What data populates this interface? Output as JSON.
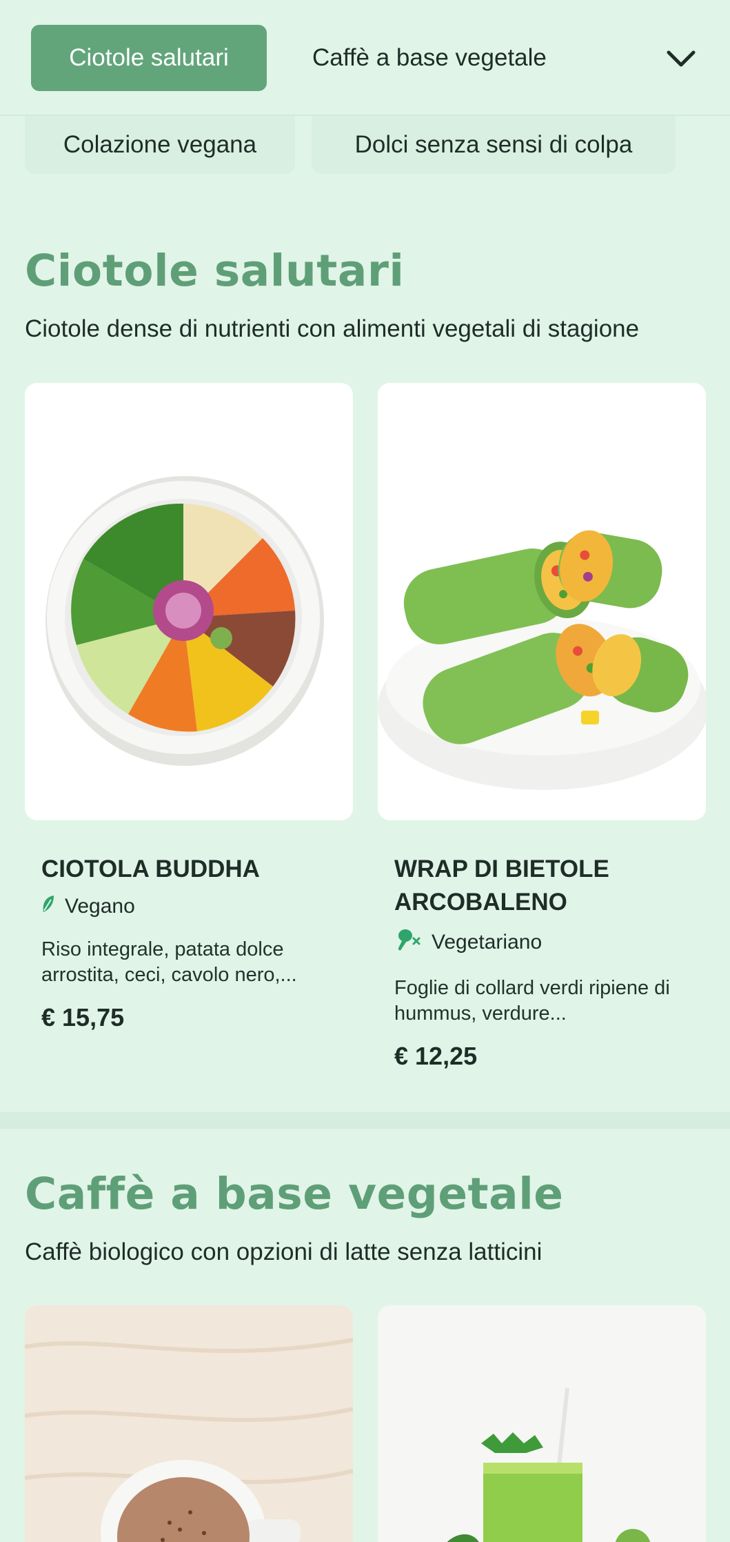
{
  "nav": {
    "active_category": "Ciotole salutari",
    "second_category": "Caffè a base vegetale",
    "row2": [
      "Colazione vegana",
      "Dolci senza sensi di colpa"
    ]
  },
  "sections": [
    {
      "title": "Ciotole salutari",
      "subtitle": "Ciotole dense di nutrienti con alimenti vegetali di stagione",
      "items": [
        {
          "name": "CIOTOLA BUDDHA",
          "tag": "Vegano",
          "tag_icon": "leaf-icon",
          "description": "Riso integrale, patata dolce arrostita, ceci, cavolo nero,...",
          "price": "€ 15,75"
        },
        {
          "name": "WRAP DI BIETOLE ARCOBALENO",
          "tag": "Vegetariano",
          "tag_icon": "no-meat-icon",
          "description": "Foglie di collard verdi ripiene di hummus, verdure...",
          "price": "€ 12,25"
        }
      ]
    },
    {
      "title": "Caffè a base vegetale",
      "subtitle": "Caffè biologico con opzioni di latte senza latticini"
    }
  ],
  "colors": {
    "background": "#e1f4e8",
    "accent": "#62a57b",
    "title_green": "#5f9f78",
    "tag_icon": "#2fa56b"
  }
}
